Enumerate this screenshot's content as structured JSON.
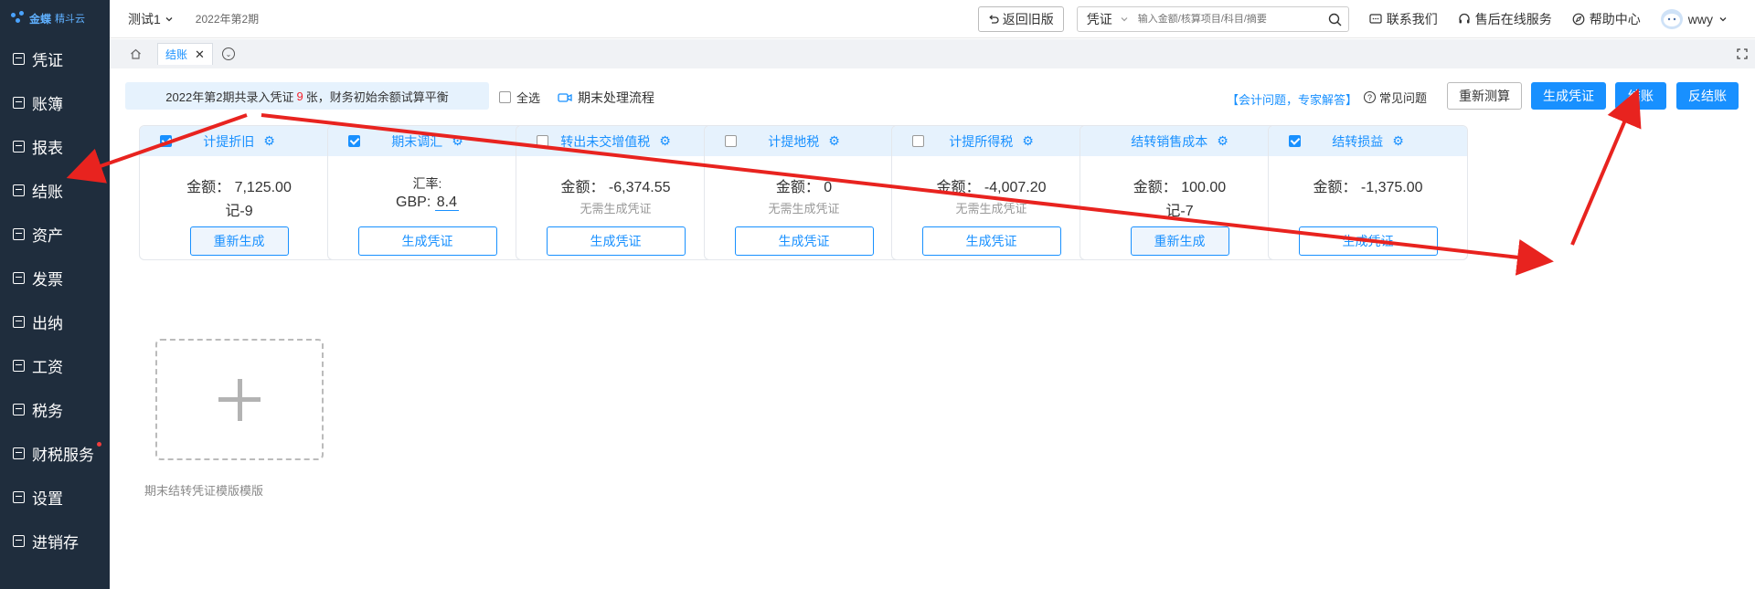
{
  "brand": {
    "name": "金蝶",
    "sub": "精斗云"
  },
  "sidebar": {
    "items": [
      {
        "label": "凭证",
        "icon": "voucher-icon"
      },
      {
        "label": "账簿",
        "icon": "ledger-icon"
      },
      {
        "label": "报表",
        "icon": "report-icon"
      },
      {
        "label": "结账",
        "icon": "closing-icon"
      },
      {
        "label": "资产",
        "icon": "asset-icon"
      },
      {
        "label": "发票",
        "icon": "invoice-icon"
      },
      {
        "label": "出纳",
        "icon": "cashier-icon"
      },
      {
        "label": "工资",
        "icon": "salary-icon"
      },
      {
        "label": "税务",
        "icon": "tax-icon"
      },
      {
        "label": "财税服务",
        "icon": "service-icon",
        "badge": true
      },
      {
        "label": "设置",
        "icon": "settings-icon"
      },
      {
        "label": "进销存",
        "icon": "inventory-icon"
      }
    ]
  },
  "header": {
    "account": "测试1",
    "period": "2022年第2期",
    "back_old": "返回旧版",
    "search_type": "凭证",
    "search_placeholder": "输入金额/核算项目/科目/摘要",
    "contact": "联系我们",
    "support": "售后在线服务",
    "help": "帮助中心",
    "user": "wwy"
  },
  "tabs": {
    "active": "结账"
  },
  "toolbar": {
    "summary_prefix": "2022年第2期共录入凭证",
    "summary_count": "9",
    "summary_suffix": "张，财务初始余额试算平衡",
    "select_all": "全选",
    "flow": "期末处理流程",
    "accounting_link": "【会计问题，专家解答】",
    "faq": "常见问题",
    "recalc": "重新测算",
    "gen_voucher": "生成凭证",
    "close": "结账",
    "unclose": "反结账"
  },
  "cards": [
    {
      "title": "计提折旧",
      "checked": true,
      "line1": "金额：  7,125.00",
      "line2": "记-9",
      "note": "",
      "button": "重新生成"
    },
    {
      "title": "期末调汇",
      "checked": true,
      "line1": "汇率:",
      "rate_currency": "GBP:",
      "rate_value": "8.4",
      "note": "",
      "button": "生成凭证"
    },
    {
      "title": "转出未交增值税",
      "checked": false,
      "line1": "金额：  -6,374.55",
      "line2": "",
      "note": "无需生成凭证",
      "button": "生成凭证"
    },
    {
      "title": "计提地税",
      "checked": false,
      "line1": "金额：  0",
      "line2": "",
      "note": "无需生成凭证",
      "button": "生成凭证"
    },
    {
      "title": "计提所得税",
      "checked": false,
      "line1": "金额：  -4,007.20",
      "line2": "",
      "note": "无需生成凭证",
      "button": "生成凭证"
    },
    {
      "title": "结转销售成本",
      "checked": null,
      "line1": "金额：  100.00",
      "line2": "记-7",
      "note": "",
      "button": "重新生成"
    },
    {
      "title": "结转损益",
      "checked": true,
      "line1": "金额：  -1,375.00",
      "line2": "",
      "note": "",
      "button": "生成凭证"
    }
  ],
  "add_template": {
    "label": "期末结转凭证模版模版"
  },
  "colors": {
    "sidebar": "#1f2d3d",
    "accent": "#1890ff",
    "annotation_arrow": "#e8231f"
  }
}
